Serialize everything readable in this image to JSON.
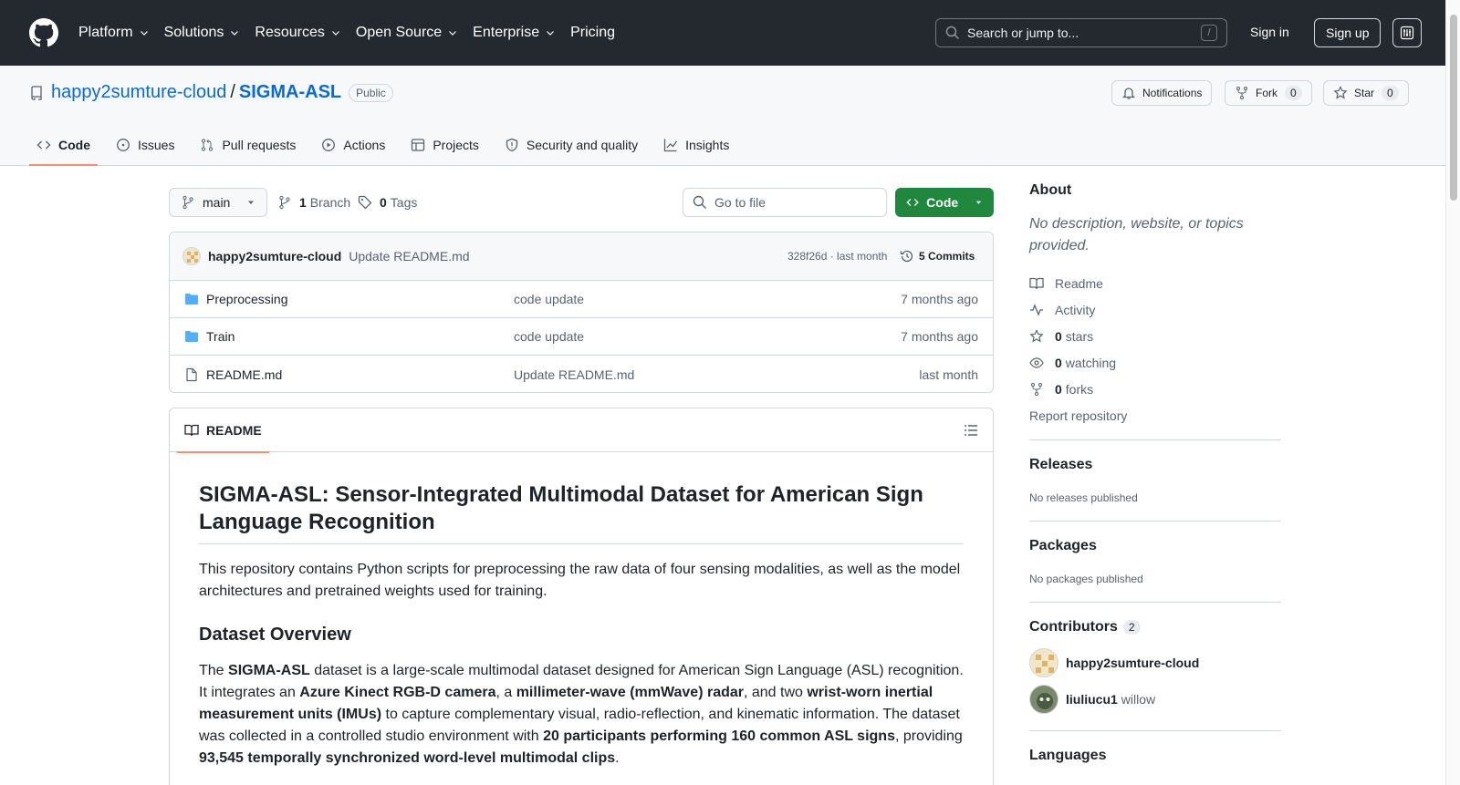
{
  "header": {
    "nav": [
      {
        "label": "Platform",
        "dropdown": true
      },
      {
        "label": "Solutions",
        "dropdown": true
      },
      {
        "label": "Resources",
        "dropdown": true
      },
      {
        "label": "Open Source",
        "dropdown": true
      },
      {
        "label": "Enterprise",
        "dropdown": true
      },
      {
        "label": "Pricing",
        "dropdown": false
      }
    ],
    "search_placeholder": "Search or jump to...",
    "search_shortcut": "/",
    "sign_in": "Sign in",
    "sign_up": "Sign up"
  },
  "repo": {
    "owner": "happy2sumture-cloud",
    "separator": "/",
    "name": "SIGMA-ASL",
    "visibility": "Public",
    "notifications": "Notifications",
    "fork": "Fork",
    "fork_count": "0",
    "star": "Star",
    "star_count": "0",
    "tabs": [
      {
        "label": "Code",
        "icon": "code-icon"
      },
      {
        "label": "Issues",
        "icon": "issue-icon"
      },
      {
        "label": "Pull requests",
        "icon": "pull-request-icon"
      },
      {
        "label": "Actions",
        "icon": "play-icon"
      },
      {
        "label": "Projects",
        "icon": "table-icon"
      },
      {
        "label": "Security and quality",
        "icon": "shield-icon"
      },
      {
        "label": "Insights",
        "icon": "graph-icon"
      }
    ]
  },
  "toolbar": {
    "branch": "main",
    "branches_count": "1",
    "branches_label": "Branch",
    "tags_count": "0",
    "tags_label": "Tags",
    "go_to_file": "Go to file",
    "code_button": "Code"
  },
  "commit": {
    "author": "happy2sumture-cloud",
    "message": "Update README.md",
    "sha": "328f26d · last month",
    "commits": "5 Commits"
  },
  "files": [
    {
      "name": "Preprocessing",
      "type": "folder",
      "message": "code update",
      "date": "7 months ago"
    },
    {
      "name": "Train",
      "type": "folder",
      "message": "code update",
      "date": "7 months ago"
    },
    {
      "name": "README.md",
      "type": "file",
      "message": "Update README.md",
      "date": "last month"
    }
  ],
  "readme": {
    "tab": "README",
    "title": "SIGMA-ASL: Sensor-Integrated Multimodal Dataset for American Sign Language Recognition",
    "intro": "This repository contains Python scripts for preprocessing the raw data of four sensing modalities, as well as the model architectures and pretrained weights used for training.",
    "h2": "Dataset Overview",
    "p2": {
      "t1": "The ",
      "b1": "SIGMA-ASL",
      "t2": " dataset is a large-scale multimodal dataset designed for American Sign Language (ASL) recognition. It integrates an ",
      "b2": "Azure Kinect RGB-D camera",
      "t3": ", a ",
      "b3": "millimeter-wave (mmWave) radar",
      "t4": ", and two ",
      "b4": "wrist-worn inertial measurement units (IMUs)",
      "t5": " to capture complementary visual, radio-reflection, and kinematic information. The dataset was collected in a controlled studio environment with ",
      "b5": "20 participants performing 160 common ASL signs",
      "t6": ", providing ",
      "b6": "93,545 temporally synchronized word-level multimodal clips",
      "t7": "."
    }
  },
  "about": {
    "title": "About",
    "description": "No description, website, or topics provided.",
    "links": [
      {
        "icon": "book-icon",
        "count": "",
        "label": "Readme"
      },
      {
        "icon": "pulse-icon",
        "count": "",
        "label": "Activity"
      },
      {
        "icon": "star-icon",
        "count": "0",
        "label": "stars"
      },
      {
        "icon": "eye-icon",
        "count": "0",
        "label": "watching"
      },
      {
        "icon": "fork-icon",
        "count": "0",
        "label": "forks"
      }
    ],
    "report": "Report repository"
  },
  "releases": {
    "title": "Releases",
    "text": "No releases published"
  },
  "packages": {
    "title": "Packages",
    "text": "No packages published"
  },
  "contributors": {
    "title": "Contributors",
    "count": "2",
    "list": [
      {
        "name": "happy2sumture-cloud",
        "extra": ""
      },
      {
        "name": "liuliucu1",
        "extra": "willow"
      }
    ]
  },
  "languages": {
    "title": "Languages"
  },
  "colors": {
    "header_bg": "#24292f",
    "link": "#0969da",
    "green": "#1f883d",
    "accent_tab": "#fd8c73"
  }
}
